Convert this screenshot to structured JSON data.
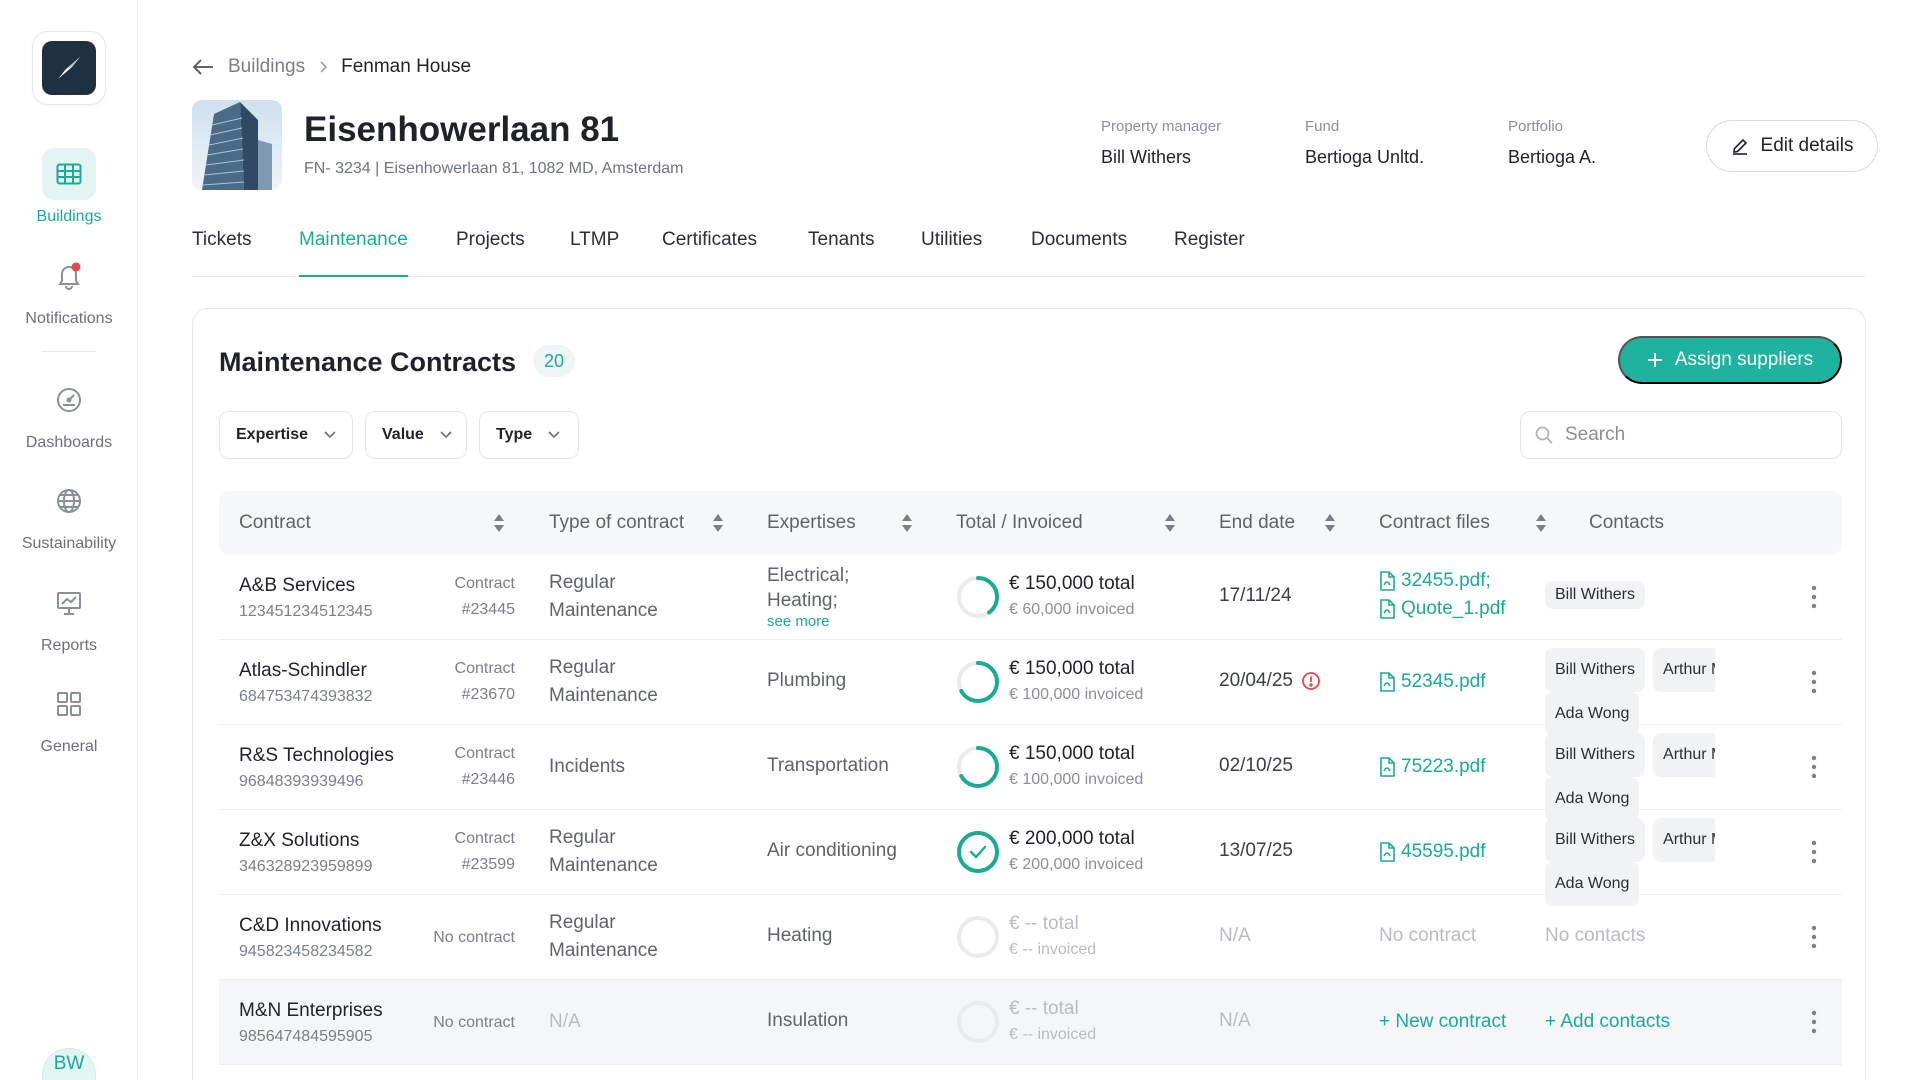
{
  "sidebar": {
    "items": [
      {
        "label": "Buildings",
        "icon": "table-icon",
        "active": true
      },
      {
        "label": "Notifications",
        "icon": "bell-icon",
        "active": false
      },
      {
        "label": "Dashboards",
        "icon": "gauge-icon",
        "active": false
      },
      {
        "label": "Sustainability",
        "icon": "globe-icon",
        "active": false
      },
      {
        "label": "Reports",
        "icon": "presentation-chart-icon",
        "active": false
      },
      {
        "label": "General",
        "icon": "grid-icon",
        "active": false
      }
    ],
    "avatar_initials": "BW"
  },
  "breadcrumb": {
    "parent": "Buildings",
    "current": "Fenman House"
  },
  "building": {
    "title": "Eisenhowerlaan 81",
    "subtitle": "FN- 3234 | Eisenhowerlaan 81, 1082 MD, Amsterdam",
    "property_manager_label": "Property manager",
    "property_manager": "Bill Withers",
    "fund_label": "Fund",
    "fund": "Bertioga Unltd.",
    "portfolio_label": "Portfolio",
    "portfolio": "Bertioga A.",
    "edit_label": "Edit details"
  },
  "tabs": [
    "Tickets",
    "Maintenance",
    "Projects",
    "LTMP",
    "Certificates",
    "Tenants",
    "Utilities",
    "Documents",
    "Register"
  ],
  "active_tab": "Maintenance",
  "card": {
    "title": "Maintenance Contracts",
    "count": "20",
    "assign_label": "Assign suppliers",
    "filters": [
      "Expertise",
      "Value",
      "Type"
    ],
    "search_placeholder": "Search"
  },
  "columns": [
    "Contract",
    "Type of contract",
    "Expertises",
    "Total / Invoiced",
    "End date",
    "Contract files",
    "Contacts"
  ],
  "rows": [
    {
      "name": "A&B Services",
      "code": "123451234512345",
      "ref1": "Contract",
      "ref2": "#23445",
      "type1": "Regular",
      "type2": "Maintenance",
      "exp1": "Electrical;",
      "exp2": "Heating;",
      "see_more": "see more",
      "total": "€ 150,000 total",
      "invoiced": "€ 60,000 invoiced",
      "progress": 0.4,
      "end_date": "17/11/24",
      "files": [
        "32455.pdf;",
        "Quote_1.pdf"
      ],
      "contacts": [
        "Bill Withers"
      ]
    },
    {
      "name": "Atlas-Schindler",
      "code": "684753474393832",
      "ref1": "Contract",
      "ref2": "#23670",
      "type1": "Regular",
      "type2": "Maintenance",
      "exp1": "Plumbing",
      "total": "€ 150,000 total",
      "invoiced": "€ 100,000 invoiced",
      "progress": 0.67,
      "end_date": "20/04/25",
      "warning": true,
      "files": [
        "52345.pdf"
      ],
      "contacts": [
        "Bill Withers",
        "Arthur M",
        "Ada Wong"
      ]
    },
    {
      "name": "R&S Technologies",
      "code": "96848393939496",
      "ref1": "Contract",
      "ref2": "#23446",
      "type1": "Incidents",
      "exp1": "Transportation",
      "total": "€ 150,000 total",
      "invoiced": "€ 100,000 invoiced",
      "progress": 0.67,
      "end_date": "02/10/25",
      "files": [
        "75223.pdf"
      ],
      "contacts": [
        "Bill Withers",
        "Arthur M",
        "Ada Wong"
      ]
    },
    {
      "name": "Z&X Solutions",
      "code": "346328923959899",
      "ref1": "Contract",
      "ref2": "#23599",
      "type1": "Regular",
      "type2": "Maintenance",
      "exp1": "Air conditioning",
      "total": "€ 200,000 total",
      "invoiced": "€ 200,000 invoiced",
      "progress": 1.0,
      "complete": true,
      "end_date": "13/07/25",
      "files": [
        "45595.pdf"
      ],
      "contacts": [
        "Bill Withers",
        "Arthur M",
        "Ada Wong"
      ]
    },
    {
      "name": "C&D Innovations",
      "code": "945823458234582",
      "ref1": "No contract",
      "type1": "Regular",
      "type2": "Maintenance",
      "exp1": "Heating",
      "total": "€ -- total",
      "invoiced": "€ -- invoiced",
      "progress": 0,
      "muted": true,
      "end_date": "N/A",
      "files_text": "No contract",
      "contacts_text": "No contacts"
    },
    {
      "name": "M&N Enterprises",
      "code": "985647484595905",
      "ref1": "No contract",
      "type1": "N/A",
      "type_muted": true,
      "exp1": "Insulation",
      "total": "€ -- total",
      "invoiced": "€ -- invoiced",
      "progress": 0,
      "muted": true,
      "end_date": "N/A",
      "files_link": "+ New contract",
      "contacts_link": "+ Add contacts",
      "highlight": true
    }
  ],
  "colors": {
    "accent": "#1aaa98",
    "accent_bg": "#e3f5f2",
    "danger": "#e5484d"
  }
}
